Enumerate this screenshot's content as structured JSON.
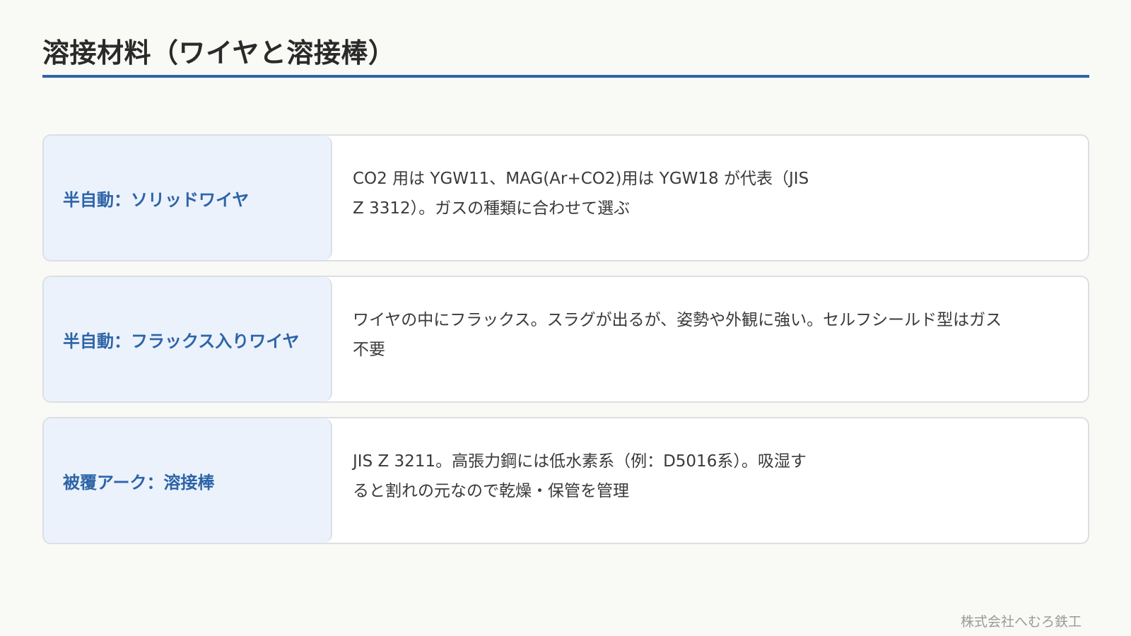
{
  "title": "溶接材料（ワイヤと溶接棒）",
  "rows": [
    {
      "label": "半自動：ソリッドワイヤ",
      "description": "CO2 用は YGW11、MAG(Ar+CO2)用は YGW18 が代表（JIS Z 3312）。ガスの種類に合わせて選ぶ"
    },
    {
      "label": "半自動：フラックス入りワイヤ",
      "description": "ワイヤの中にフラックス。スラグが出るが、姿勢や外観に強い。セルフシールド型はガス不要"
    },
    {
      "label": "被覆アーク：溶接棒",
      "description": "JIS Z 3211。高張力鋼には低水素系（例：D5016系）。吸湿すると割れの元なので乾燥・保管を管理"
    }
  ],
  "footer": {
    "company": "株式会社へむろ鉄工"
  }
}
